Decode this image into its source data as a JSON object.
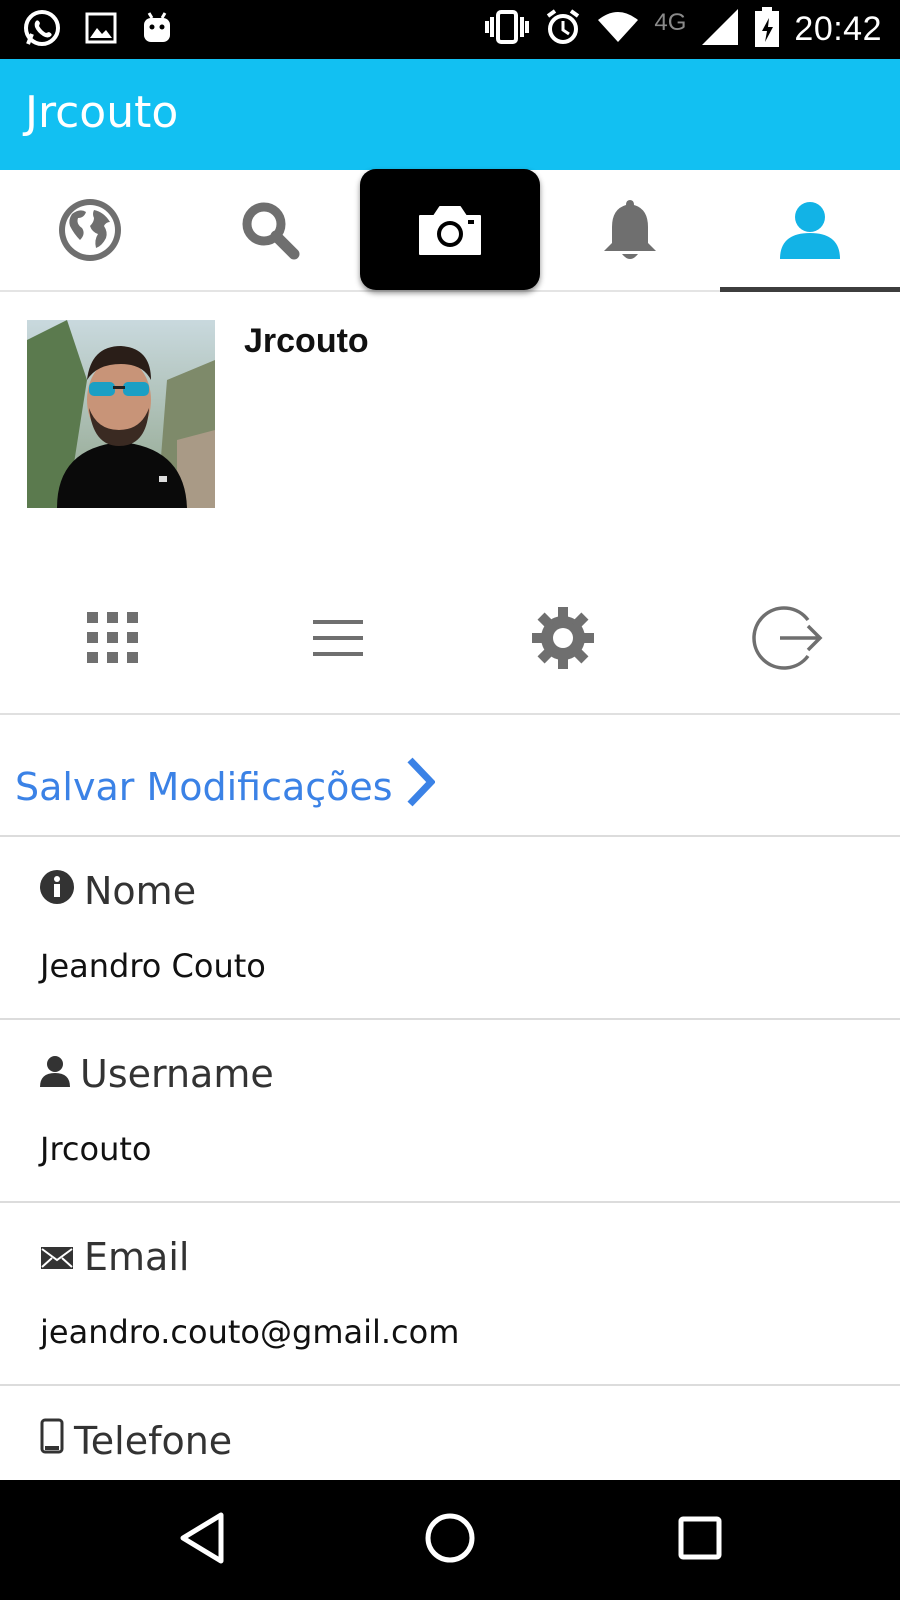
{
  "status_bar": {
    "time": "20:42",
    "network": "4G",
    "left_icons": [
      "whatsapp-icon",
      "gallery-icon",
      "android-icon"
    ],
    "right_icons": [
      "vibrate-icon",
      "alarm-icon",
      "wifi-icon",
      "signal-icon",
      "battery-icon"
    ]
  },
  "app_bar": {
    "title": "Jrcouto",
    "color": "#12c0f2"
  },
  "tabs": [
    {
      "name": "globe-icon",
      "active": false
    },
    {
      "name": "search-icon",
      "active": false
    },
    {
      "name": "camera-icon",
      "active": false,
      "highlighted": true
    },
    {
      "name": "bell-icon",
      "active": false
    },
    {
      "name": "user-icon",
      "active": true
    }
  ],
  "profile": {
    "name": "Jrcouto"
  },
  "profile_actions": [
    "grid-icon",
    "list-icon",
    "gear-icon",
    "logout-icon"
  ],
  "save": {
    "label": "Salvar Modificações",
    "color": "#3b82e6"
  },
  "fields": [
    {
      "icon": "info-icon",
      "label": "Nome",
      "value": "Jeandro Couto"
    },
    {
      "icon": "user-icon",
      "label": "Username",
      "value": "Jrcouto"
    },
    {
      "icon": "envelope-icon",
      "label": "Email",
      "value": "jeandro.couto@gmail.com"
    },
    {
      "icon": "phone-icon",
      "label": "Telefone",
      "value": ""
    }
  ],
  "nav_bar": [
    "back-icon",
    "home-icon",
    "recents-icon"
  ]
}
